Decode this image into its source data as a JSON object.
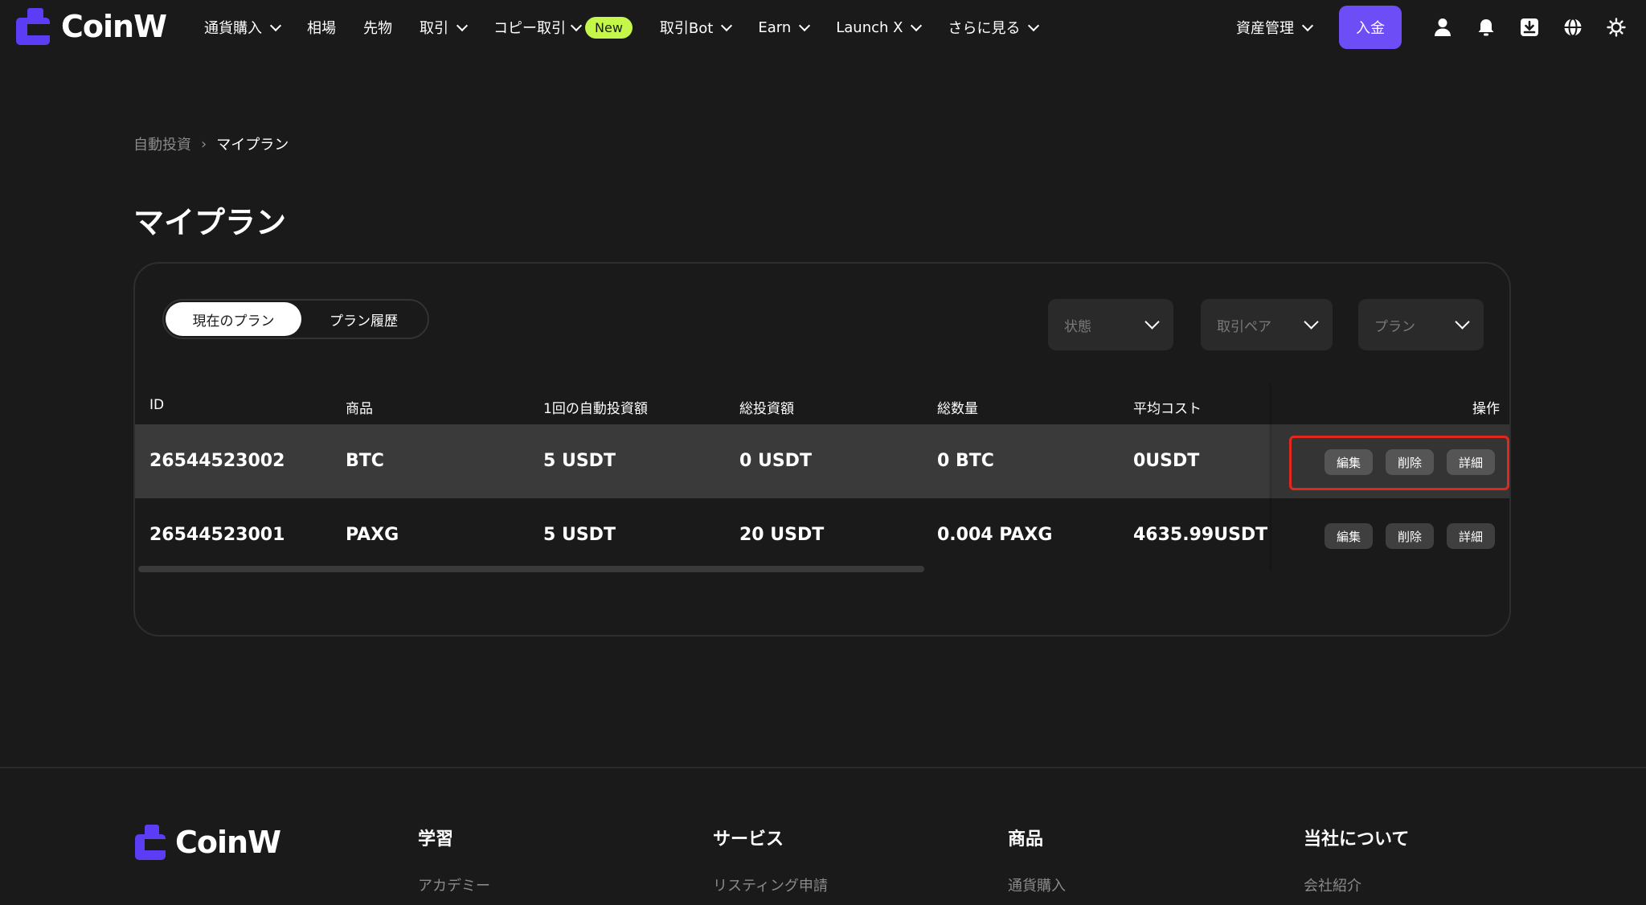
{
  "brand": {
    "name": "CoinW",
    "color": "#5d3cf5"
  },
  "nav": {
    "items": [
      {
        "label": "通貨購入",
        "dropdown": true
      },
      {
        "label": "相場",
        "dropdown": false
      },
      {
        "label": "先物",
        "dropdown": false
      },
      {
        "label": "取引",
        "dropdown": true
      },
      {
        "label": "コピー取引",
        "dropdown": true,
        "badge": "New"
      },
      {
        "label": "取引Bot",
        "dropdown": true
      },
      {
        "label": "Earn",
        "dropdown": true
      },
      {
        "label": "Launch X",
        "dropdown": true
      },
      {
        "label": "さらに見る",
        "dropdown": true
      }
    ],
    "asset_management": "資産管理",
    "deposit": "入金",
    "icons": [
      "user-icon",
      "bell-icon",
      "download-icon",
      "globe-icon",
      "sun-icon"
    ]
  },
  "breadcrumb": {
    "parent": "自動投資",
    "current": "マイプラン"
  },
  "page_title": "マイプラン",
  "tabs": {
    "current": "現在のプラン",
    "history": "プラン履歴"
  },
  "filters": {
    "status": "状態",
    "pair": "取引ペア",
    "plan": "プラン"
  },
  "table": {
    "headers": {
      "id": "ID",
      "product": "商品",
      "per_amount": "1回の自動投資額",
      "total_invested": "総投資額",
      "total_qty": "総数量",
      "avg_cost": "平均コスト",
      "actions": "操作"
    },
    "rows": [
      {
        "id": "26544523002",
        "product": "BTC",
        "per_amount": "5 USDT",
        "total_invested": "0 USDT",
        "total_qty": "0 BTC",
        "avg_cost": "0USDT"
      },
      {
        "id": "26544523001",
        "product": "PAXG",
        "per_amount": "5 USDT",
        "total_invested": "20 USDT",
        "total_qty": "0.004 PAXG",
        "avg_cost": "4635.99USDT"
      }
    ],
    "actions": {
      "edit": "編集",
      "delete": "削除",
      "detail": "詳細"
    }
  },
  "footer": {
    "columns": [
      {
        "title": "学習",
        "first_link": "アカデミー"
      },
      {
        "title": "サービス",
        "first_link": "リスティング申請"
      },
      {
        "title": "商品",
        "first_link": "通貨購入"
      },
      {
        "title": "当社について",
        "first_link": "会社紹介"
      }
    ]
  }
}
